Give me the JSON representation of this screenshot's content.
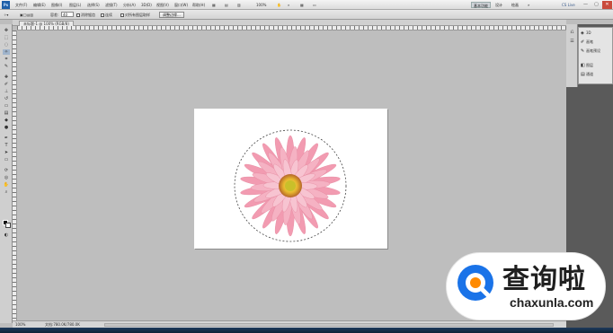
{
  "app": {
    "logo_text": "Ps"
  },
  "menu": [
    {
      "label": "文件(F)"
    },
    {
      "label": "编辑(E)"
    },
    {
      "label": "图像(I)"
    },
    {
      "label": "图层(L)"
    },
    {
      "label": "选择(S)"
    },
    {
      "label": "滤镜(T)"
    },
    {
      "label": "分析(A)"
    },
    {
      "label": "3D(D)"
    },
    {
      "label": "视图(V)"
    },
    {
      "label": "窗口(W)"
    },
    {
      "label": "帮助(H)"
    }
  ],
  "top_controls": {
    "zoom_level": "100%"
  },
  "workspaces": {
    "essentials": "基本功能",
    "design": "设计",
    "painting": "绘画"
  },
  "cs_live": "CS Live",
  "window_controls": {
    "minimize": "—",
    "maximize": "▢",
    "close": "✕"
  },
  "options_bar": {
    "feather_label": "容差:",
    "feather_value": "40",
    "antialias_label": "消除锯齿",
    "contiguous_label": "连续",
    "sample_all_label": "对所有图层取样",
    "refine_edge_button": "调整边缘..."
  },
  "document": {
    "tab_title": "未标题-1 @ 100% (RGB/8)",
    "zoom_status": "100%",
    "doc_size": "文档:780.0K/780.0K"
  },
  "panels": {
    "items": [
      {
        "icon": "3D-icon",
        "label": "3D"
      },
      {
        "icon": "brush-icon",
        "label": "画笔"
      },
      {
        "icon": "brush-presets-icon",
        "label": "画笔预设"
      },
      {
        "icon": "layers-icon",
        "label": "图层"
      },
      {
        "icon": "channels-icon",
        "label": "通道"
      }
    ]
  },
  "watermark": {
    "title": "查询啦",
    "url": "chaxunla.com",
    "brand_color": "#1a73e8"
  },
  "colors": {
    "foreground": "#000000",
    "background": "#ffffff",
    "flower_petal": "#f2a3b5",
    "flower_center": "#e6c531"
  }
}
